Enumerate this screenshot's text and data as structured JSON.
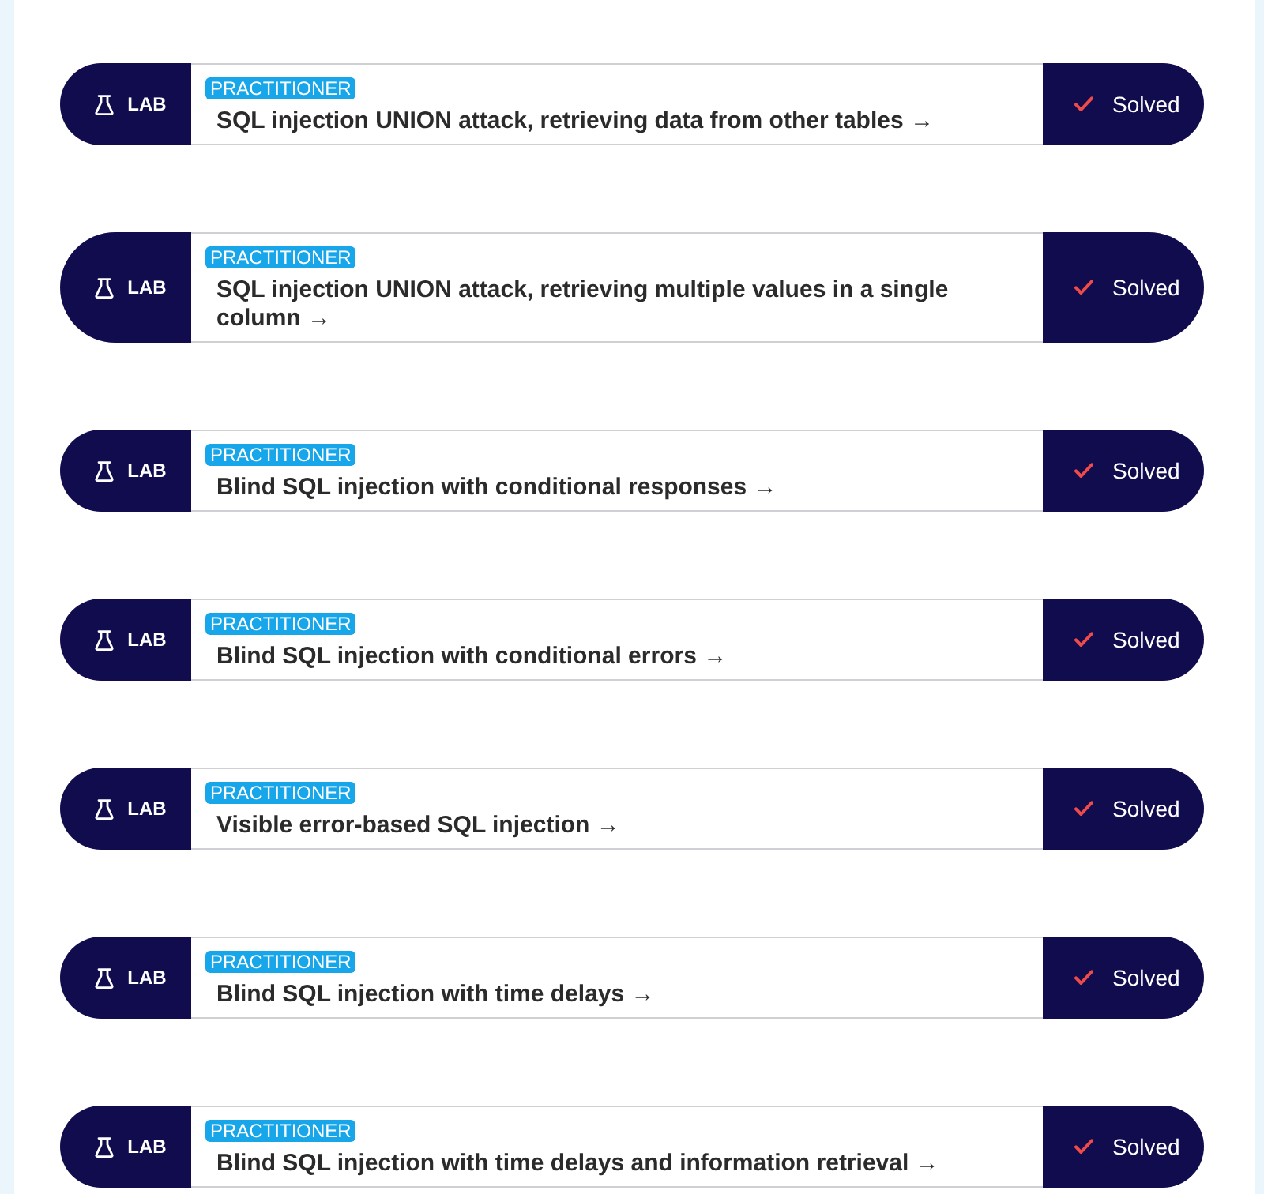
{
  "labs": [
    {
      "tag": "LAB",
      "level": "PRACTITIONER",
      "title": "SQL injection UNION attack, retrieving data from other tables →",
      "status": "Solved",
      "solved": true
    },
    {
      "tag": "LAB",
      "level": "PRACTITIONER",
      "title": "SQL injection UNION attack, retrieving multiple values in a single column →",
      "status": "Solved",
      "solved": true
    },
    {
      "tag": "LAB",
      "level": "PRACTITIONER",
      "title": "Blind SQL injection with conditional responses →",
      "status": "Solved",
      "solved": true
    },
    {
      "tag": "LAB",
      "level": "PRACTITIONER",
      "title": "Blind SQL injection with conditional errors →",
      "status": "Solved",
      "solved": true
    },
    {
      "tag": "LAB",
      "level": "PRACTITIONER",
      "title": "Visible error-based SQL injection →",
      "status": "Solved",
      "solved": true
    },
    {
      "tag": "LAB",
      "level": "PRACTITIONER",
      "title": "Blind SQL injection with time delays →",
      "status": "Solved",
      "solved": true
    },
    {
      "tag": "LAB",
      "level": "PRACTITIONER",
      "title": "Blind SQL injection with time delays and information retrieval →",
      "status": "Solved",
      "solved": true
    }
  ]
}
